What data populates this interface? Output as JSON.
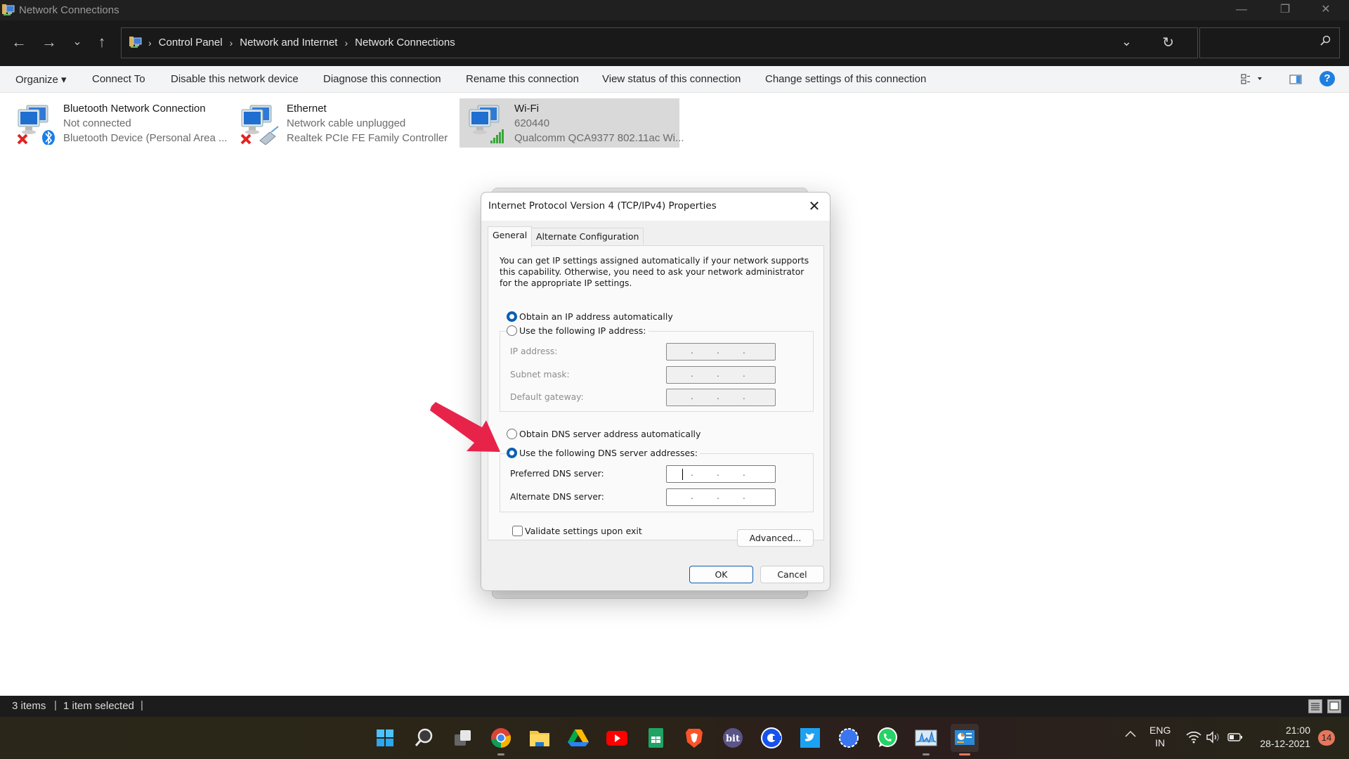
{
  "window": {
    "title": "Network Connections",
    "controls": {
      "minimize": "—",
      "restore": "❐",
      "close": "✕"
    }
  },
  "nav": {
    "back_icon": "←",
    "forward_icon": "→",
    "recent_icon": "⌄",
    "up_icon": "↑",
    "breadcrumbs": [
      "Control Panel",
      "Network and Internet",
      "Network Connections"
    ],
    "crumb_separator": "›",
    "dropdown_icon": "⌄",
    "refresh_icon": "↻",
    "search_placeholder": "",
    "search_icon": "⚲"
  },
  "toolbar": {
    "items": [
      "Organize ▾",
      "Connect To",
      "Disable this network device",
      "Diagnose this connection",
      "Rename this connection",
      "View status of this connection",
      "Change settings of this connection"
    ],
    "help_label": "?"
  },
  "connections": [
    {
      "name": "Bluetooth Network Connection",
      "status": "Not connected",
      "device": "Bluetooth Device (Personal Area ...",
      "selected": false,
      "overlay": "bluetooth"
    },
    {
      "name": "Ethernet",
      "status": "Network cable unplugged",
      "device": "Realtek PCIe FE Family Controller",
      "selected": false,
      "overlay": "cable"
    },
    {
      "name": "Wi-Fi",
      "status": "620440",
      "device": "Qualcomm QCA9377 802.11ac Wi...",
      "selected": true,
      "overlay": "signal"
    }
  ],
  "dialog": {
    "title": "Internet Protocol Version 4 (TCP/IPv4) Properties",
    "close_icon": "✕",
    "tabs": [
      "General",
      "Alternate Configuration"
    ],
    "active_tab": "General",
    "description": "You can get IP settings assigned automatically if your network supports this capability. Otherwise, you need to ask your network administrator for the appropriate IP settings.",
    "ip_mode": {
      "auto_label": "Obtain an IP address automatically",
      "manual_label": "Use the following IP address:",
      "selected": "auto"
    },
    "ip_fields": [
      {
        "label": "IP address:",
        "value": ". . ."
      },
      {
        "label": "Subnet mask:",
        "value": ". . ."
      },
      {
        "label": "Default gateway:",
        "value": ". . ."
      }
    ],
    "dns_mode": {
      "auto_label": "Obtain DNS server address automatically",
      "manual_label": "Use the following DNS server addresses:",
      "selected": "manual"
    },
    "dns_fields": [
      {
        "label": "Preferred DNS server:",
        "value": ". . .",
        "focused": true
      },
      {
        "label": "Alternate DNS server:",
        "value": ". . .",
        "focused": false
      }
    ],
    "validate_label": "Validate settings upon exit",
    "validate_checked": false,
    "advanced_label": "Advanced...",
    "ok_label": "OK",
    "cancel_label": "Cancel"
  },
  "annotation": {
    "arrow_color": "#e8234a",
    "points_to": "Use the following DNS server addresses"
  },
  "statusbar": {
    "item_count": "3 items",
    "selection": "1 item selected",
    "separator": "|"
  },
  "taskbar": {
    "apps": [
      {
        "name": "start",
        "label": ""
      },
      {
        "name": "search",
        "label": ""
      },
      {
        "name": "task-view",
        "label": ""
      },
      {
        "name": "chrome",
        "label": ""
      },
      {
        "name": "file-explorer",
        "label": ""
      },
      {
        "name": "google-drive",
        "label": ""
      },
      {
        "name": "youtube",
        "label": ""
      },
      {
        "name": "google-sheets",
        "label": ""
      },
      {
        "name": "brave",
        "label": ""
      },
      {
        "name": "bit",
        "label": "bit"
      },
      {
        "name": "coinbase",
        "label": ""
      },
      {
        "name": "twitter",
        "label": ""
      },
      {
        "name": "signal",
        "label": ""
      },
      {
        "name": "whatsapp",
        "label": ""
      },
      {
        "name": "resource-monitor",
        "label": ""
      },
      {
        "name": "control-panel",
        "label": ""
      }
    ],
    "tray": {
      "chevron": "^",
      "lang_top": "ENG",
      "lang_bottom": "IN",
      "time": "21:00",
      "date": "28-12-2021",
      "notifications": "14"
    }
  }
}
